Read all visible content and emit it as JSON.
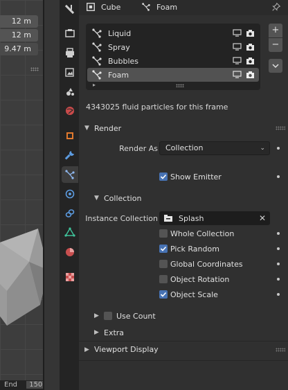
{
  "viewport": {
    "dims": [
      "12 m",
      "12 m",
      "9.47 m"
    ],
    "timeline": {
      "label": "End",
      "value": "150"
    }
  },
  "header": {
    "object_name": "Cube",
    "particle_system_name": "Foam"
  },
  "particle_systems": {
    "items": [
      {
        "label": "Liquid",
        "selected": false
      },
      {
        "label": "Spray",
        "selected": false
      },
      {
        "label": "Bubbles",
        "selected": false
      },
      {
        "label": "Foam",
        "selected": true
      }
    ],
    "add_label": "+",
    "remove_label": "−",
    "dropdown_label": "⌄"
  },
  "info": "4343025 fluid particles for this frame",
  "render": {
    "title": "Render",
    "render_as_label": "Render As",
    "render_as_value": "Collection",
    "show_emitter_label": "Show Emitter",
    "show_emitter": true
  },
  "collection": {
    "title": "Collection",
    "instance_label": "Instance Collection",
    "instance_value": "Splash",
    "options": [
      {
        "label": "Whole Collection",
        "checked": false
      },
      {
        "label": "Pick Random",
        "checked": true
      },
      {
        "label": "Global Coordinates",
        "checked": false
      },
      {
        "label": "Object Rotation",
        "checked": false
      },
      {
        "label": "Object Scale",
        "checked": true
      }
    ],
    "use_count_label": "Use Count",
    "use_count": false
  },
  "extra": {
    "title": "Extra"
  },
  "viewport_display": {
    "title": "Viewport Display"
  },
  "colors": {
    "accent": "#4772b3",
    "panel": "#303030",
    "selected_row": "#525252"
  }
}
